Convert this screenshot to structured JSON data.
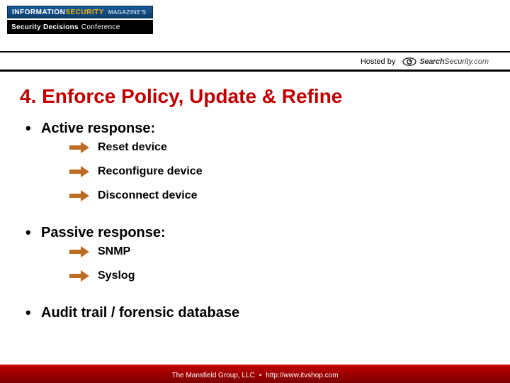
{
  "header": {
    "logo_infosec": {
      "info": "INFORMATION",
      "sec": "SECURITY",
      "mag": "MAGAZINE'S"
    },
    "logo_sdc": {
      "sd": "Security Decisions",
      "conf": "Conference"
    },
    "hosted_by_label": "Hosted by",
    "search_security": {
      "part1": "Search",
      "part2": "Security",
      "part3": ".com"
    }
  },
  "title": "4. Enforce Policy, Update & Refine",
  "bullets": {
    "active": {
      "label": "Active response:",
      "items": [
        "Reset device",
        "Reconfigure device",
        "Disconnect device"
      ]
    },
    "passive": {
      "label": "Passive response:",
      "items": [
        "SNMP",
        "Syslog"
      ]
    },
    "audit": {
      "label": "Audit trail / forensic database"
    }
  },
  "footer": {
    "org": "The Mansfield Group, LLC",
    "url": "http://www.itvshop.com"
  }
}
